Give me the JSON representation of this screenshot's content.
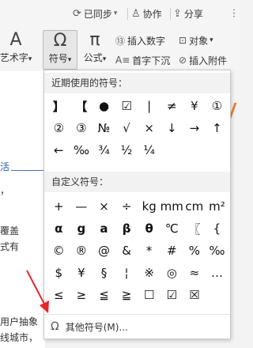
{
  "top_actions": [
    {
      "icon": "cloud-sync-icon",
      "glyph": "⟳",
      "label": "已同步"
    },
    {
      "icon": "collab-icon",
      "glyph": "♙",
      "label": "协作"
    },
    {
      "icon": "share-icon",
      "glyph": "⇪",
      "label": "分享"
    }
  ],
  "toolbar": {
    "art_label": "艺术字",
    "symbol_label": "符号",
    "formula_label": "公式",
    "insert_number": "插入数字",
    "object": "对象",
    "drop_cap": "首字下沉",
    "attachment": "插入附件"
  },
  "document": {
    "lines": [
      "活",
      "，",
      "覆盖",
      "式有",
      "用户抽象",
      "线城市，"
    ]
  },
  "panel": {
    "recent_title": "近期使用的符号：",
    "recent_symbols": [
      "】",
      "【",
      "●",
      "☑",
      "|",
      "≠",
      "¥",
      "①",
      "②",
      "③",
      "№",
      "√",
      "×",
      "↓",
      "→",
      "↑",
      "←",
      "‰",
      "¾",
      "½",
      "¼"
    ],
    "custom_title": "自定义符号：",
    "custom_symbols": [
      "+",
      "—",
      "×",
      "÷",
      "kg",
      "mm",
      "cm",
      "m²",
      "α",
      "g",
      "a",
      "β",
      "θ",
      "℃",
      "〖",
      "{",
      "©",
      "®",
      "@",
      "&",
      "*",
      "#",
      "%",
      "‰",
      "$",
      "¥",
      "§",
      "¦",
      "※",
      "◎",
      "≈",
      "…",
      "≤",
      "≥",
      "≦",
      "≧",
      "☐",
      "☑",
      "☒"
    ],
    "more_label": "其他符号(M)..."
  },
  "colors": {
    "accent_red": "#e8262a",
    "highlight": "#4a6fb5",
    "orange": "#f07a2a"
  }
}
